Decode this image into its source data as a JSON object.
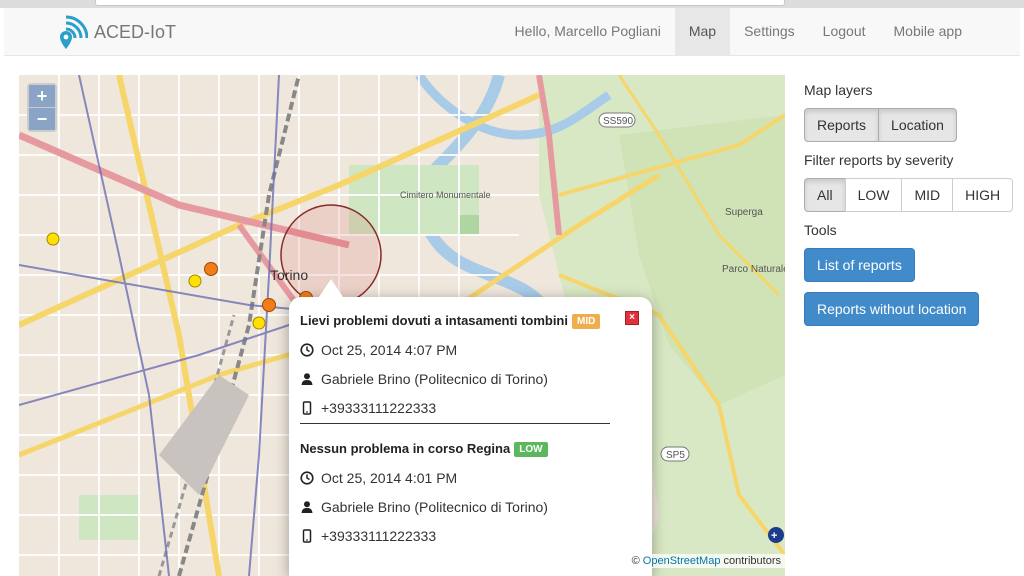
{
  "brand": {
    "name": "ACED-IoT",
    "logo_icon": "wifi-pin-logo",
    "accent": "#2a9fc9"
  },
  "nav": {
    "greeting": "Hello, Marcello Pogliani",
    "items": [
      {
        "label": "Map",
        "active": true
      },
      {
        "label": "Settings",
        "active": false
      },
      {
        "label": "Logout",
        "active": false
      },
      {
        "label": "Mobile app",
        "active": false
      }
    ]
  },
  "map": {
    "zoom_in": "+",
    "zoom_out": "−",
    "labels": {
      "city": "Torino",
      "cimitero": "Cimitero Monumentale",
      "parco": "Parco Naturale della Collina di Superga",
      "superga": "Superga",
      "road_ss590": "SS590",
      "road_sp5": "SP5"
    },
    "attribution": {
      "prefix": "©",
      "link": "OpenStreetMap",
      "suffix": "contributors"
    },
    "marker_colors": {
      "low": "#ffe000",
      "mid": "#f07d1a"
    }
  },
  "popup": {
    "close_label": "×",
    "reports": [
      {
        "title": "Lievi problemi dovuti a intasamenti tombini",
        "severity": "MID",
        "datetime": "Oct 25, 2014 4:07 PM",
        "author": "Gabriele Brino (Politecnico di Torino)",
        "phone": "+39333111222333"
      },
      {
        "title": "Nessun problema in corso Regina",
        "severity": "LOW",
        "datetime": "Oct 25, 2014 4:01 PM",
        "author": "Gabriele Brino (Politecnico di Torino)",
        "phone": "+39333111222333"
      }
    ]
  },
  "sidebar": {
    "layers_label": "Map layers",
    "layers": [
      {
        "label": "Reports",
        "active": true
      },
      {
        "label": "Location",
        "active": true
      }
    ],
    "filter_label": "Filter reports by severity",
    "filters": [
      {
        "label": "All",
        "active": true
      },
      {
        "label": "LOW",
        "active": false
      },
      {
        "label": "MID",
        "active": false
      },
      {
        "label": "HIGH",
        "active": false
      }
    ],
    "tools_label": "Tools",
    "tools": [
      {
        "label": "List of reports"
      },
      {
        "label": "Reports without location"
      }
    ]
  }
}
